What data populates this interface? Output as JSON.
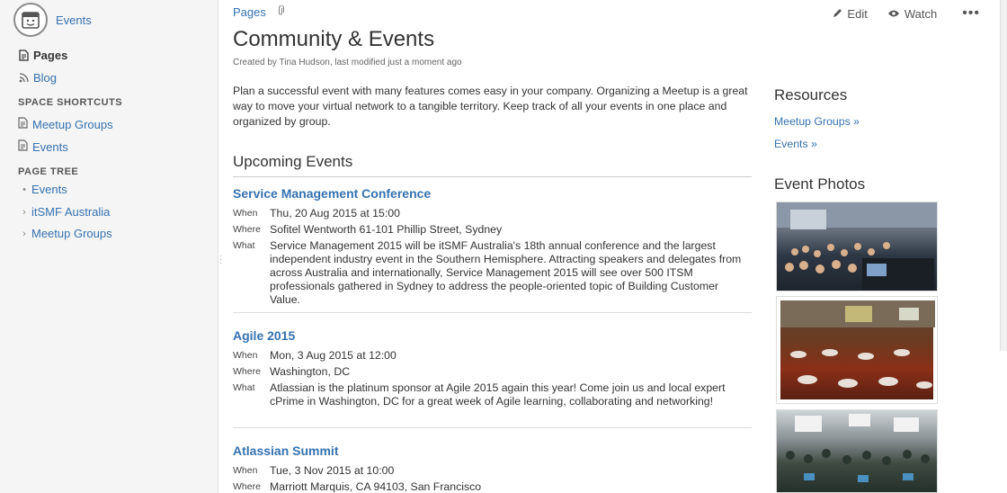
{
  "sidebar": {
    "space_name": "Events",
    "nav": {
      "pages": "Pages",
      "blog": "Blog"
    },
    "shortcuts_heading": "SPACE SHORTCUTS",
    "shortcuts": [
      "Meetup Groups",
      "Events"
    ],
    "tree_heading": "PAGE TREE",
    "tree": [
      "Events",
      "itSMF Australia",
      "Meetup Groups"
    ]
  },
  "topbar": {
    "breadcrumb": "Pages",
    "edit": "Edit",
    "watch": "Watch",
    "more": "•••"
  },
  "page": {
    "title": "Community & Events",
    "byline": "Created by Tina Hudson, last modified just a moment ago",
    "intro": "Plan a successful event with many features comes easy in your company. Organizing a Meetup is a great way to move your virtual network to a tangible territory. Keep track of all your events in one place and organized by group.",
    "upcoming_heading": "Upcoming Events",
    "labels": {
      "when": "When",
      "where": "Where",
      "what": "What"
    },
    "events": [
      {
        "title": "Service Management Conference",
        "when": "Thu, 20 Aug 2015 at 15:00",
        "where": "Sofitel Wentworth 61-101 Phillip Street, Sydney",
        "what": "Service Management 2015 will be itSMF Australia's 18th annual conference and the largest independent industry event in the Southern Hemisphere. Attracting speakers and delegates from across Australia and internationally, Service Management 2015 will see over 500 ITSM professionals gathered in Sydney to address the people-oriented topic of Building Customer Value."
      },
      {
        "title": "Agile 2015",
        "when": "Mon, 3 Aug 2015 at 12:00",
        "where": "Washington, DC",
        "what": "Atlassian is the platinum sponsor at Agile 2015 again this year! Come join us and local expert cPrime in Washington, DC for a great week of Agile learning, collaborating and networking!"
      },
      {
        "title": "Atlassian Summit",
        "when": "Tue, 3 Nov 2015 at 10:00",
        "where": "Marriott Marquis, CA 94103, San Francisco"
      }
    ]
  },
  "right": {
    "resources_heading": "Resources",
    "resources": [
      "Meetup Groups »",
      "Events »"
    ],
    "photos_heading": "Event Photos"
  },
  "colors": {
    "link": "#3572b0",
    "text": "#333333",
    "sidebar_bg": "#f5f5f5"
  }
}
